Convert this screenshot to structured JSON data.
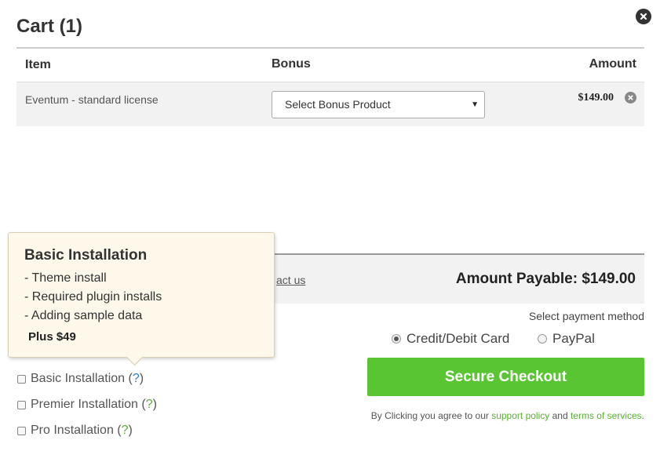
{
  "cart": {
    "title": "Cart (1)"
  },
  "table": {
    "headers": {
      "item": "Item",
      "bonus": "Bonus",
      "amount": "Amount"
    },
    "rows": [
      {
        "item": "Eventum - standard license",
        "bonus_selected": "Select Bonus Product",
        "amount": "$149.00"
      }
    ]
  },
  "summary": {
    "contact_link": "act us",
    "amount_payable": "Amount Payable: $149.00"
  },
  "payment": {
    "label": "Select payment method",
    "options": [
      {
        "label": "Credit/Debit Card",
        "selected": true
      },
      {
        "label": "PayPal",
        "selected": false
      }
    ]
  },
  "checkout": {
    "button": "Secure Checkout",
    "terms_prefix": "By Clicking you agree to our",
    "support_policy": "support policy",
    "terms_and": "and",
    "terms_of_services": "terms of services",
    "terms_suffix": "."
  },
  "addons": [
    {
      "name": "Basic Installation",
      "open": "(",
      "q": "?",
      "close": ")",
      "checked": false
    },
    {
      "name": "Premier Installation",
      "open": "(",
      "q": "?",
      "close": ")",
      "checked": false
    },
    {
      "name": "Pro Installation",
      "open": "(",
      "q": "?",
      "close": ")",
      "checked": false
    }
  ],
  "tooltip": {
    "title": "Basic Installation",
    "lines": [
      "- Theme install",
      "- Required plugin installs",
      "- Adding sample data"
    ],
    "price": "Plus $49"
  },
  "colors": {
    "accent_green": "#5ac532",
    "link_green": "#5ab034",
    "link_blue": "#2a7fc4"
  },
  "icons": {
    "close": "close-circle-icon",
    "remove": "remove-circle-icon",
    "dropdown": "caret-down-icon"
  }
}
